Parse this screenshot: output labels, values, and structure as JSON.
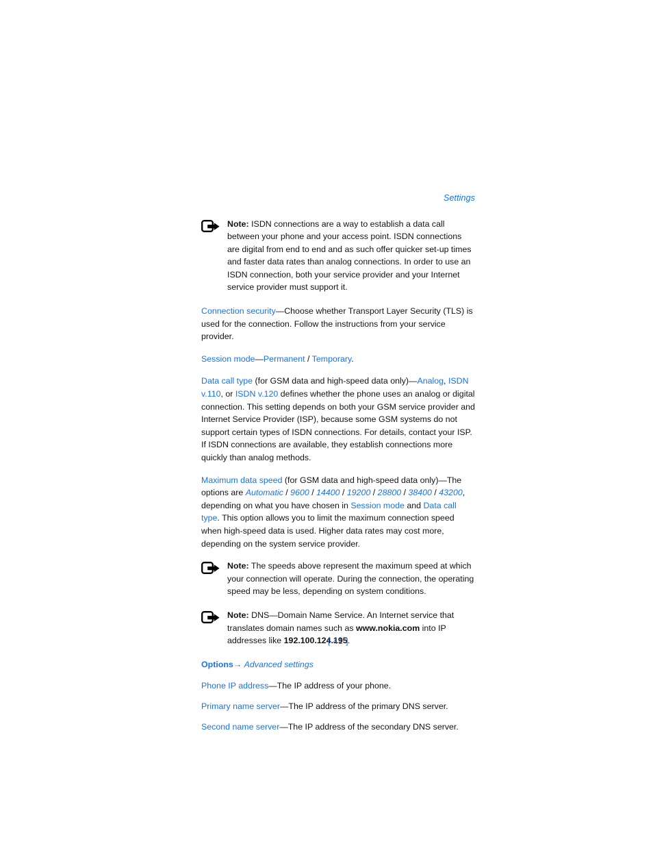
{
  "page": {
    "running_head": "Settings",
    "folio": "[ 41 ]",
    "accent_color": "#1a72e8",
    "text_color": "#131313",
    "background": "#ffffff"
  },
  "notes": {
    "icon_name": "note-arrow-icon",
    "label": "Note:",
    "isdn": {
      "label": "Note:",
      "body": " ISDN connections are a way to establish a data call between your phone and your access point. ISDN connections are digital from end to end and as such offer quicker set-up times and faster data rates than analog connections. In order to use an ISDN connection, both your service provider and your Internet service provider must support it."
    },
    "speeds": {
      "label": "Note:",
      "body": " The speeds above represent the maximum speed at which your connection will operate. During the connection, the operating speed may be less, depending on system conditions."
    },
    "dns": {
      "label": "Note:",
      "part1": " DNS—Domain Name Service. An Internet service that translates domain names such as ",
      "domain": "www.nokia.com",
      "part2": " into IP addresses like ",
      "ip": "192.100.124.195",
      "part3": "."
    }
  },
  "settings": {
    "connection_security": {
      "term": "Connection security",
      "body": "—Choose whether Transport Layer Security (TLS) is used for the connection. Follow the instructions from your service provider."
    },
    "session_mode": {
      "term": "Session mode",
      "dash": "—",
      "value1": "Permanent",
      "separator": " / ",
      "value2": "Temporary",
      "period": "."
    },
    "data_call_type": {
      "term": "Data call type",
      "qualifier": " (for GSM data and high-speed data only)—",
      "value1": "Analog",
      "sep1": ", ",
      "value2": "ISDN v.110",
      "sep2": ", or ",
      "value3": "ISDN v.120",
      "body": " defines whether the phone uses an analog or digital connection. This setting depends on both your GSM service provider and Internet Service Provider (ISP), because some GSM systems do not support certain types of ISDN connections. For details, contact your ISP. If ISDN connections are available, they establish connections more quickly than analog methods."
    },
    "maximum_data_speed": {
      "term": "Maximum data speed",
      "qualifier": " (for GSM data and high-speed data only)—The options are ",
      "options": [
        "Automatic",
        "9600",
        "14400",
        "19200",
        "28800",
        "38400",
        "43200"
      ],
      "option_separator": " / ",
      "mid": ", depending on what you have chosen in ",
      "ref1": "Session mode",
      "conjunction": " and ",
      "ref2": "Data call type",
      "body": ". This option allows you to limit the maximum connection speed when high-speed data is used. Higher data rates may cost more, depending on the system service provider."
    }
  },
  "advanced": {
    "menu_label": "Options",
    "menu_arrow": "→",
    "menu_target": "Advanced settings",
    "items": [
      {
        "term": "Phone IP address",
        "body": "—The IP address of your phone."
      },
      {
        "term": "Primary name server",
        "body": "—The IP address of the primary DNS server."
      },
      {
        "term": "Second name server",
        "body": "—The IP address of the secondary DNS server."
      }
    ]
  }
}
